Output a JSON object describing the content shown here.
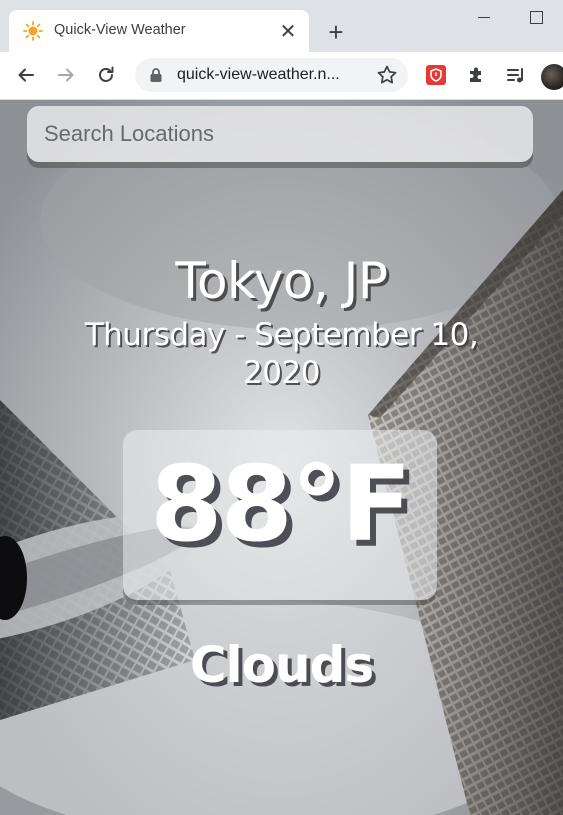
{
  "browser": {
    "tab": {
      "title": "Quick-View Weather",
      "favicon": "sun-icon",
      "close_label": "✕"
    },
    "new_tab_label": "+",
    "omnibox": {
      "url": "quick-view-weather.n..."
    },
    "icons": [
      "back-arrow-icon",
      "forward-arrow-icon",
      "reload-icon",
      "lock-icon",
      "star-icon",
      "shield-extension-icon",
      "puzzle-extensions-icon",
      "media-queue-icon",
      "avatar"
    ]
  },
  "app": {
    "search": {
      "placeholder": "Search Locations",
      "value": ""
    },
    "location": "Tokyo, JP",
    "date": "Thursday - September 10, 2020",
    "temperature": "88°F",
    "condition": "Clouds"
  },
  "colors": {
    "accent_extension": "#e53935",
    "favicon_sun": "#f5a623",
    "text_on_photo": "#ffffff"
  }
}
